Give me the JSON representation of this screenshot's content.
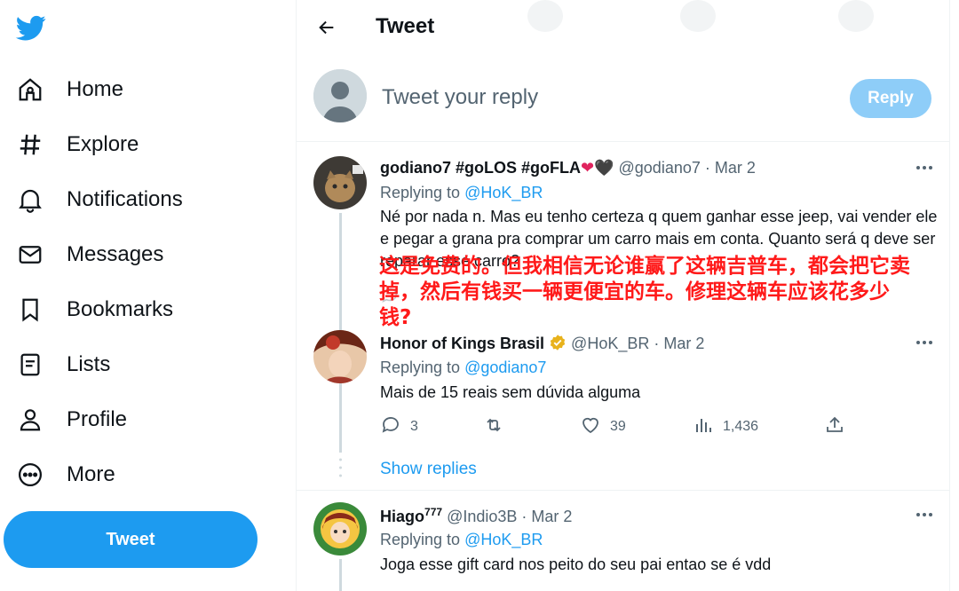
{
  "nav": {
    "items": [
      {
        "label": "Home",
        "icon": "home-icon"
      },
      {
        "label": "Explore",
        "icon": "hashtag-icon"
      },
      {
        "label": "Notifications",
        "icon": "bell-icon"
      },
      {
        "label": "Messages",
        "icon": "envelope-icon"
      },
      {
        "label": "Bookmarks",
        "icon": "bookmark-icon"
      },
      {
        "label": "Lists",
        "icon": "list-icon"
      },
      {
        "label": "Profile",
        "icon": "person-icon"
      },
      {
        "label": "More",
        "icon": "more-circle-icon"
      }
    ],
    "tweet_button": "Tweet"
  },
  "header": {
    "title": "Tweet"
  },
  "composer": {
    "placeholder": "Tweet your reply",
    "reply_button": "Reply"
  },
  "tweets": [
    {
      "name": "godiano7 #goLOS #goFLA",
      "emoji": "❤🖤",
      "handle": "@godiano7",
      "date": "Mar 2",
      "replying_label": "Replying to",
      "replying_to": "@HoK_BR",
      "text": "Né por nada n. Mas eu tenho certeza q quem ganhar esse jeep, vai vender ele e pegar a grana pra comprar um carro mais em conta. Quanto será q deve ser reparar esse carro?"
    },
    {
      "name": "Honor of Kings Brasil",
      "handle": "@HoK_BR",
      "date": "Mar 2",
      "replying_label": "Replying to",
      "replying_to": "@godiano7",
      "text": "Mais de 15 reais sem dúvida alguma",
      "replies": "3",
      "likes": "39",
      "views": "1,436"
    },
    {
      "name": "Hiago",
      "name_sup": "777",
      "handle": "@Indio3B",
      "date": "Mar 2",
      "replying_label": "Replying to",
      "replying_to": "@HoK_BR",
      "text": "Joga esse gift card nos peito do seu pai entao se é vdd"
    }
  ],
  "show_replies": "Show replies",
  "overlay_text": "这是免费的。但我相信无论谁赢了这辆吉普车，都会把它卖掉，然后有钱买一辆更便宜的车。修理这辆车应该花多少钱?",
  "colors": {
    "accent": "#1d9bf0",
    "overlay": "#ff1a1a",
    "verified": "#e8b21c"
  }
}
